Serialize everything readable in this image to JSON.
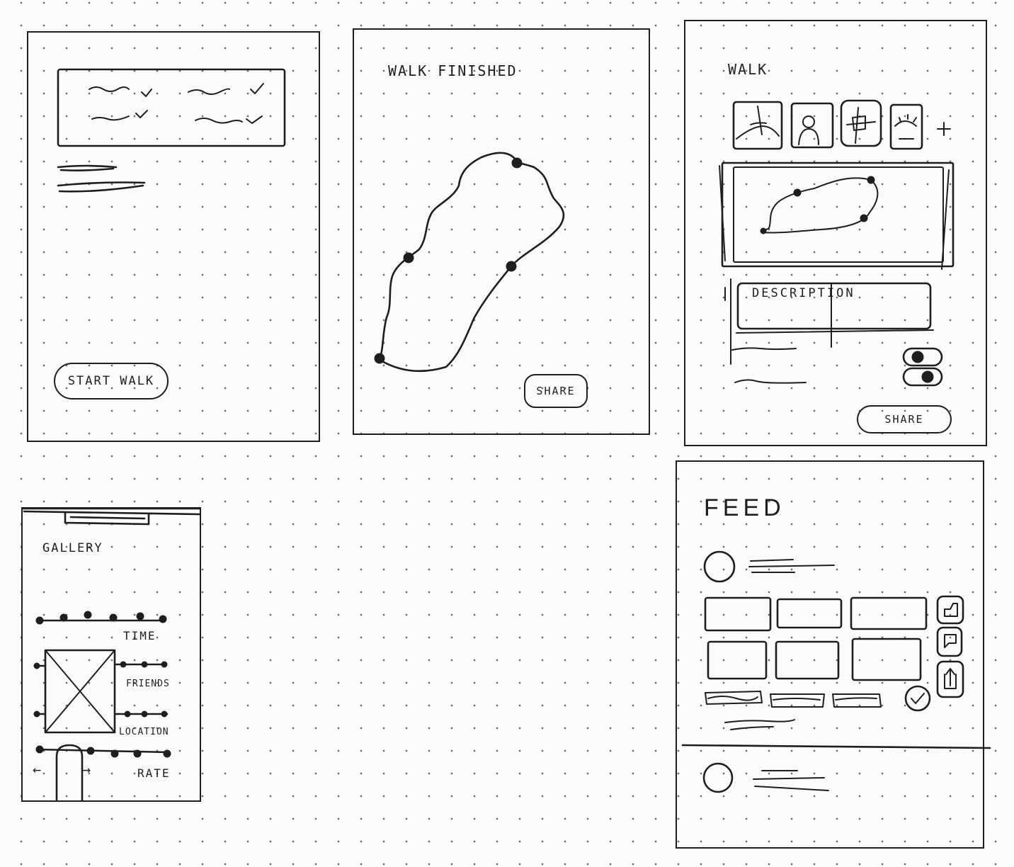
{
  "screens": {
    "start": {
      "start_button_label": "START WALK"
    },
    "finished": {
      "title": "WALK FINISHED",
      "share_label": "SHARE"
    },
    "walk": {
      "title": "WALK",
      "add_photo_symbol": "+",
      "description_label": "DESCRIPTION",
      "share_label": "SHARE"
    },
    "gallery": {
      "title": "GALLERY",
      "filters": [
        "TIME",
        "FRIENDS",
        "LOCATION",
        "RATE"
      ],
      "arrow_left": "←",
      "arrow_right": "→"
    },
    "feed": {
      "title": "FEED"
    }
  },
  "icons": {
    "gallery_image": "image-placeholder-icon",
    "like": "thumbs-up-icon",
    "comment": "comment-icon",
    "share": "share-icon",
    "check": "check-circle-icon"
  }
}
